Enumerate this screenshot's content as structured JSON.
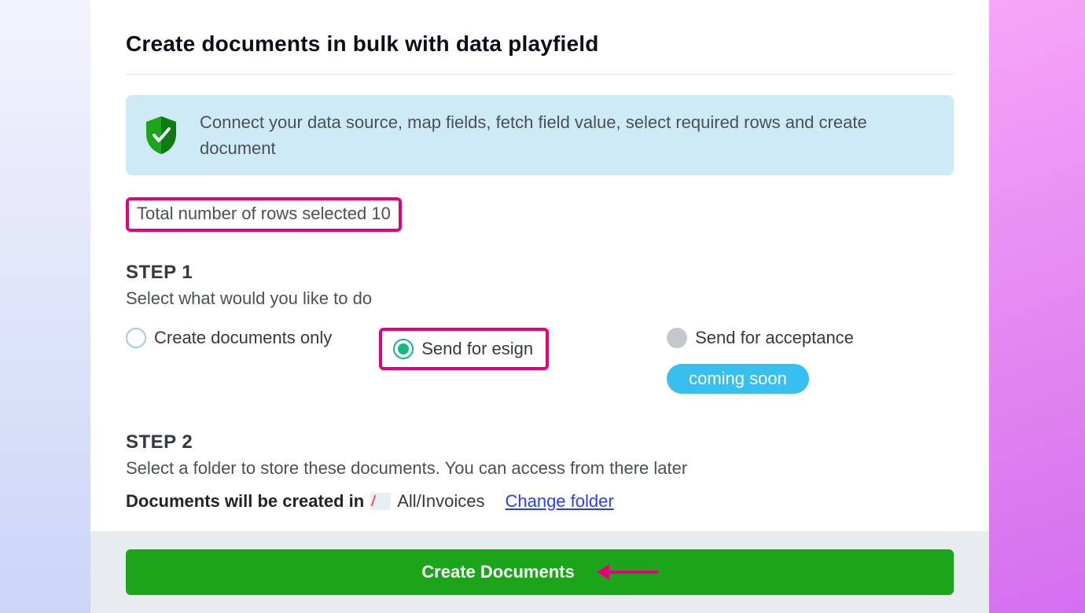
{
  "page": {
    "title": "Create documents in bulk with data playfield"
  },
  "info_banner": {
    "text": "Connect your data source, map fields, fetch field value, select required rows and create document"
  },
  "rows_selected": {
    "text": "Total number of rows selected 10"
  },
  "step1": {
    "label": "STEP 1",
    "subtitle": "Select what would you like to do",
    "options": {
      "create_only": {
        "label": "Create documents only",
        "selected": false
      },
      "send_esign": {
        "label": "Send for esign",
        "selected": true
      },
      "send_accept": {
        "label": "Send for acceptance",
        "enabled": false,
        "badge": "coming soon"
      }
    }
  },
  "step2": {
    "label": "STEP 2",
    "subtitle": "Select a folder to store these documents. You can access from there later",
    "lead": "Documents will be created in",
    "path": "All/Invoices",
    "change_link": "Change folder"
  },
  "footer": {
    "create_button": "Create Documents"
  }
}
